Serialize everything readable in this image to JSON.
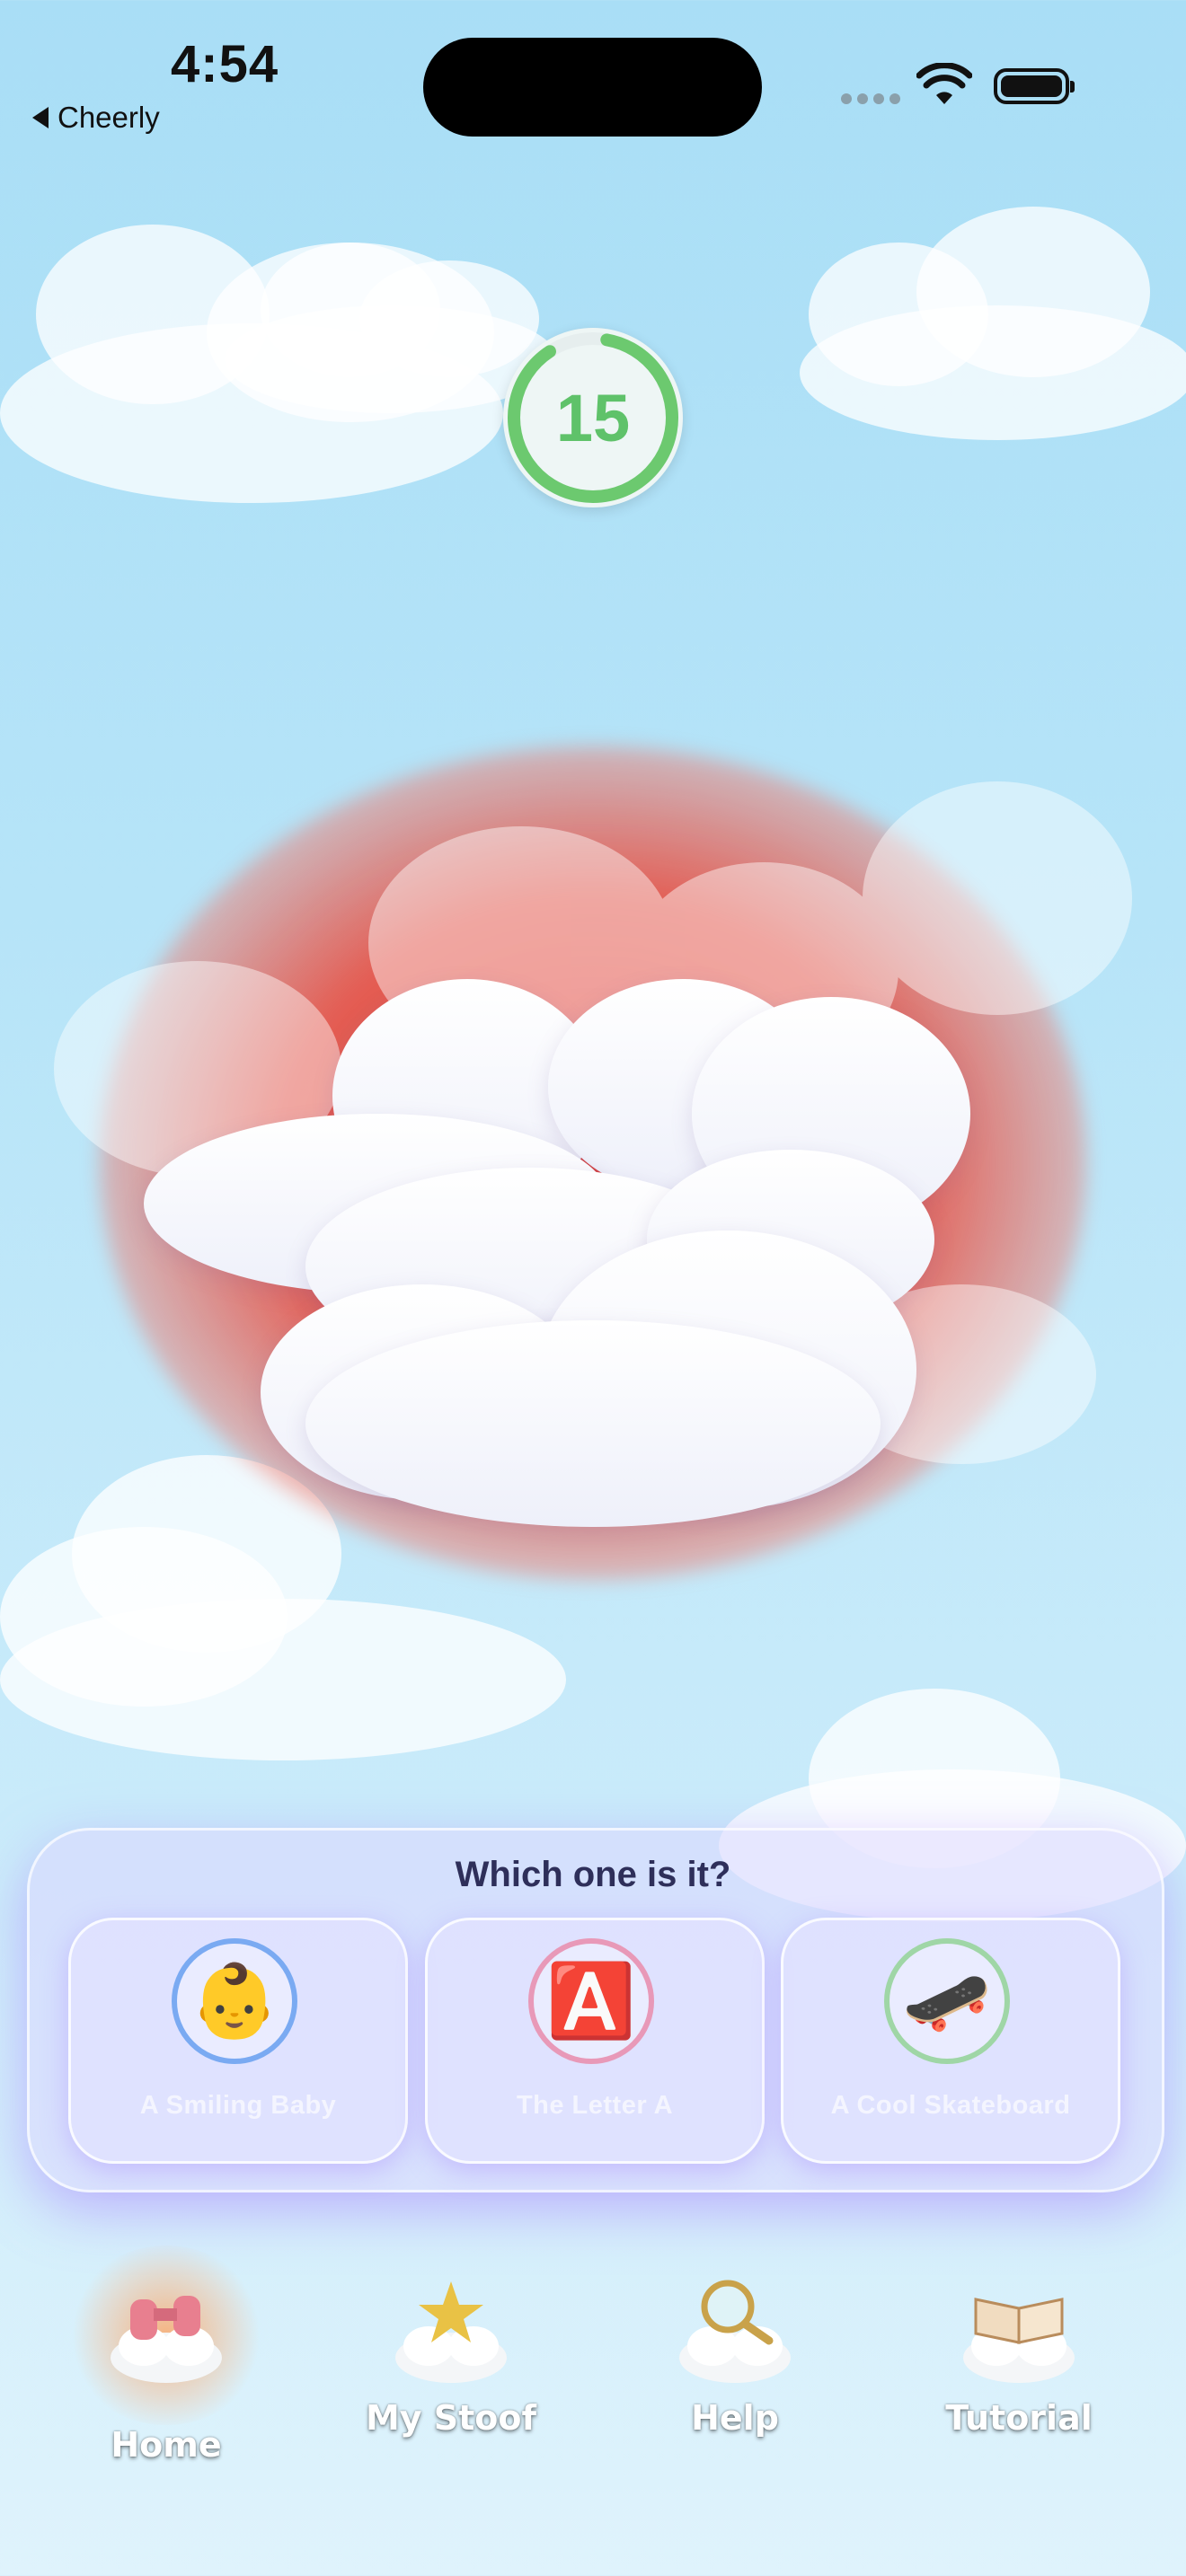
{
  "status_bar": {
    "time": "4:54",
    "back_label": "Cheerly"
  },
  "timer": {
    "value": "15",
    "progress": 0.88,
    "color": "#6cc96f"
  },
  "question": "Which one is it?",
  "answers": [
    {
      "label": "A Smiling Baby",
      "emoji": "👶",
      "ring_color": "#7aaaf2",
      "icon": "baby-icon"
    },
    {
      "label": "The Letter A",
      "emoji": "🅰️",
      "ring_color": "#e899b8",
      "icon": "letter-a-icon"
    },
    {
      "label": "A Cool Skateboard",
      "emoji": "🛹",
      "ring_color": "#9fd6a6",
      "icon": "skateboard-icon"
    }
  ],
  "tabs": [
    {
      "label": "Home",
      "icon": "binoculars-cloud-icon",
      "active": true
    },
    {
      "label": "My Stoof",
      "icon": "star-cloud-icon",
      "active": false
    },
    {
      "label": "Help",
      "icon": "magnifier-cloud-icon",
      "active": false
    },
    {
      "label": "Tutorial",
      "icon": "book-cloud-icon",
      "active": false
    }
  ],
  "colors": {
    "accent_glow": "#e8392c",
    "panel_glow": "#b18cff",
    "question_text": "#2e2f5a"
  }
}
